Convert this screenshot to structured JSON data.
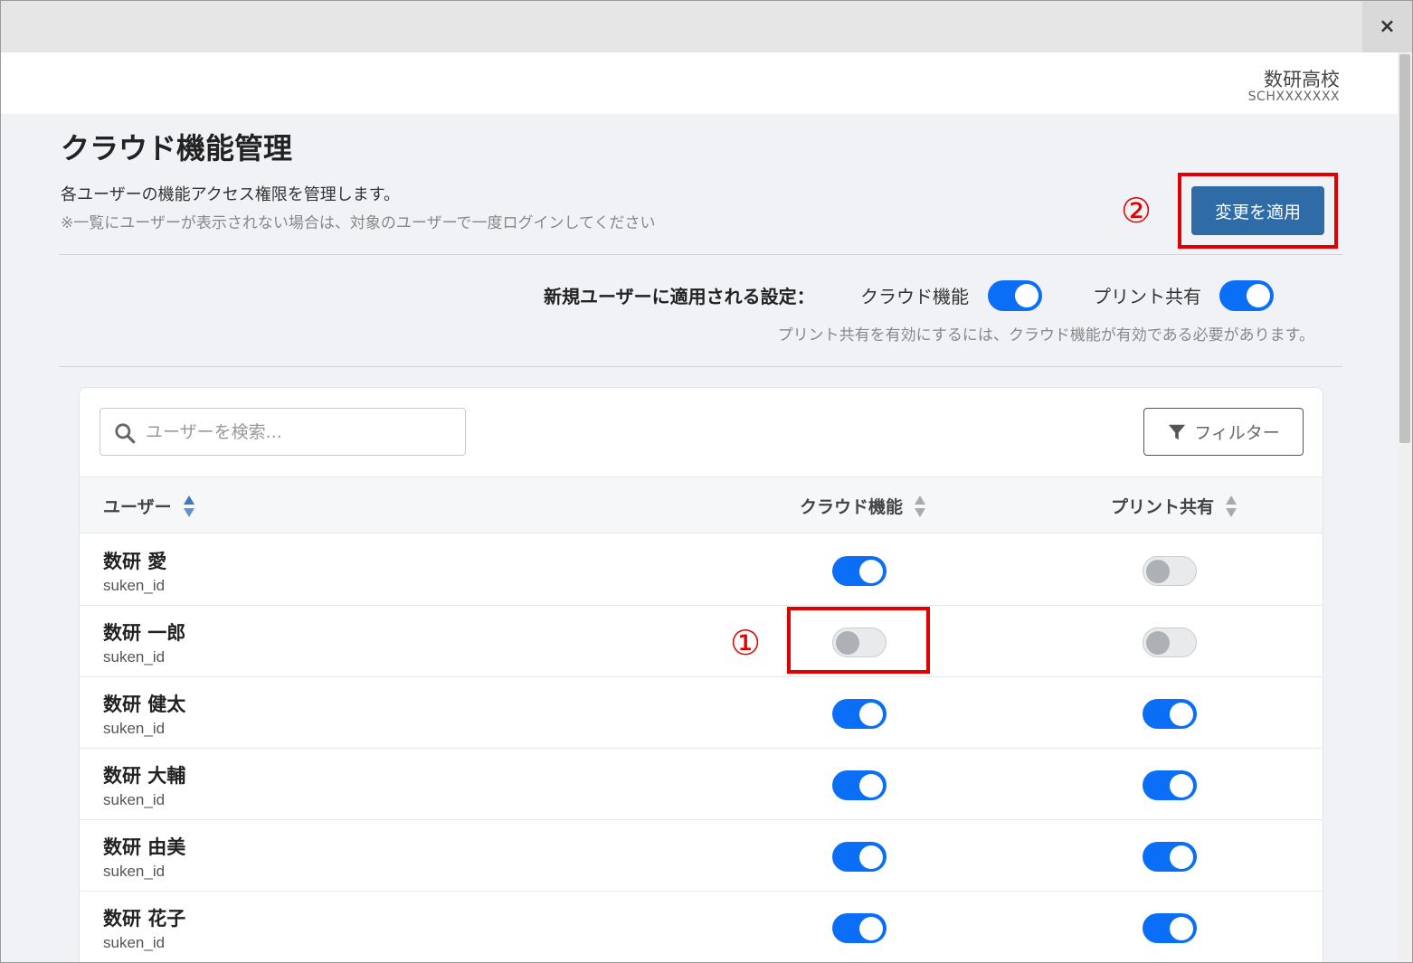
{
  "window": {
    "close_label": "×"
  },
  "school": {
    "name": "数研高校",
    "code": "SCHXXXXXXX"
  },
  "page": {
    "title": "クラウド機能管理",
    "description": "各ユーザーの機能アクセス権限を管理します。",
    "note": "※一覧にユーザーが表示されない場合は、対象のユーザーで一度ログインしてください",
    "apply_button": "変更を適用"
  },
  "annotations": {
    "step1": "①",
    "step2": "②"
  },
  "defaults": {
    "label": "新規ユーザーに適用される設定：",
    "cloud_label": "クラウド機能",
    "cloud_enabled": true,
    "print_label": "プリント共有",
    "print_enabled": true,
    "note": "プリント共有を有効にするには、クラウド機能が有効である必要があります。"
  },
  "search": {
    "placeholder": "ユーザーを検索...",
    "value": ""
  },
  "filter": {
    "label": "フィルター"
  },
  "table": {
    "columns": [
      "ユーザー",
      "クラウド機能",
      "プリント共有"
    ],
    "rows": [
      {
        "name": "数研 愛",
        "id": "suken_id",
        "cloud": true,
        "print": false
      },
      {
        "name": "数研 一郎",
        "id": "suken_id",
        "cloud": false,
        "print": false
      },
      {
        "name": "数研 健太",
        "id": "suken_id",
        "cloud": true,
        "print": true
      },
      {
        "name": "数研 大輔",
        "id": "suken_id",
        "cloud": true,
        "print": true
      },
      {
        "name": "数研 由美",
        "id": "suken_id",
        "cloud": true,
        "print": true
      },
      {
        "name": "数研 花子",
        "id": "suken_id",
        "cloud": true,
        "print": true
      }
    ]
  },
  "colors": {
    "accent": "#0b6ef6",
    "button": "#2e6ba7",
    "annotation": "#e10000"
  }
}
